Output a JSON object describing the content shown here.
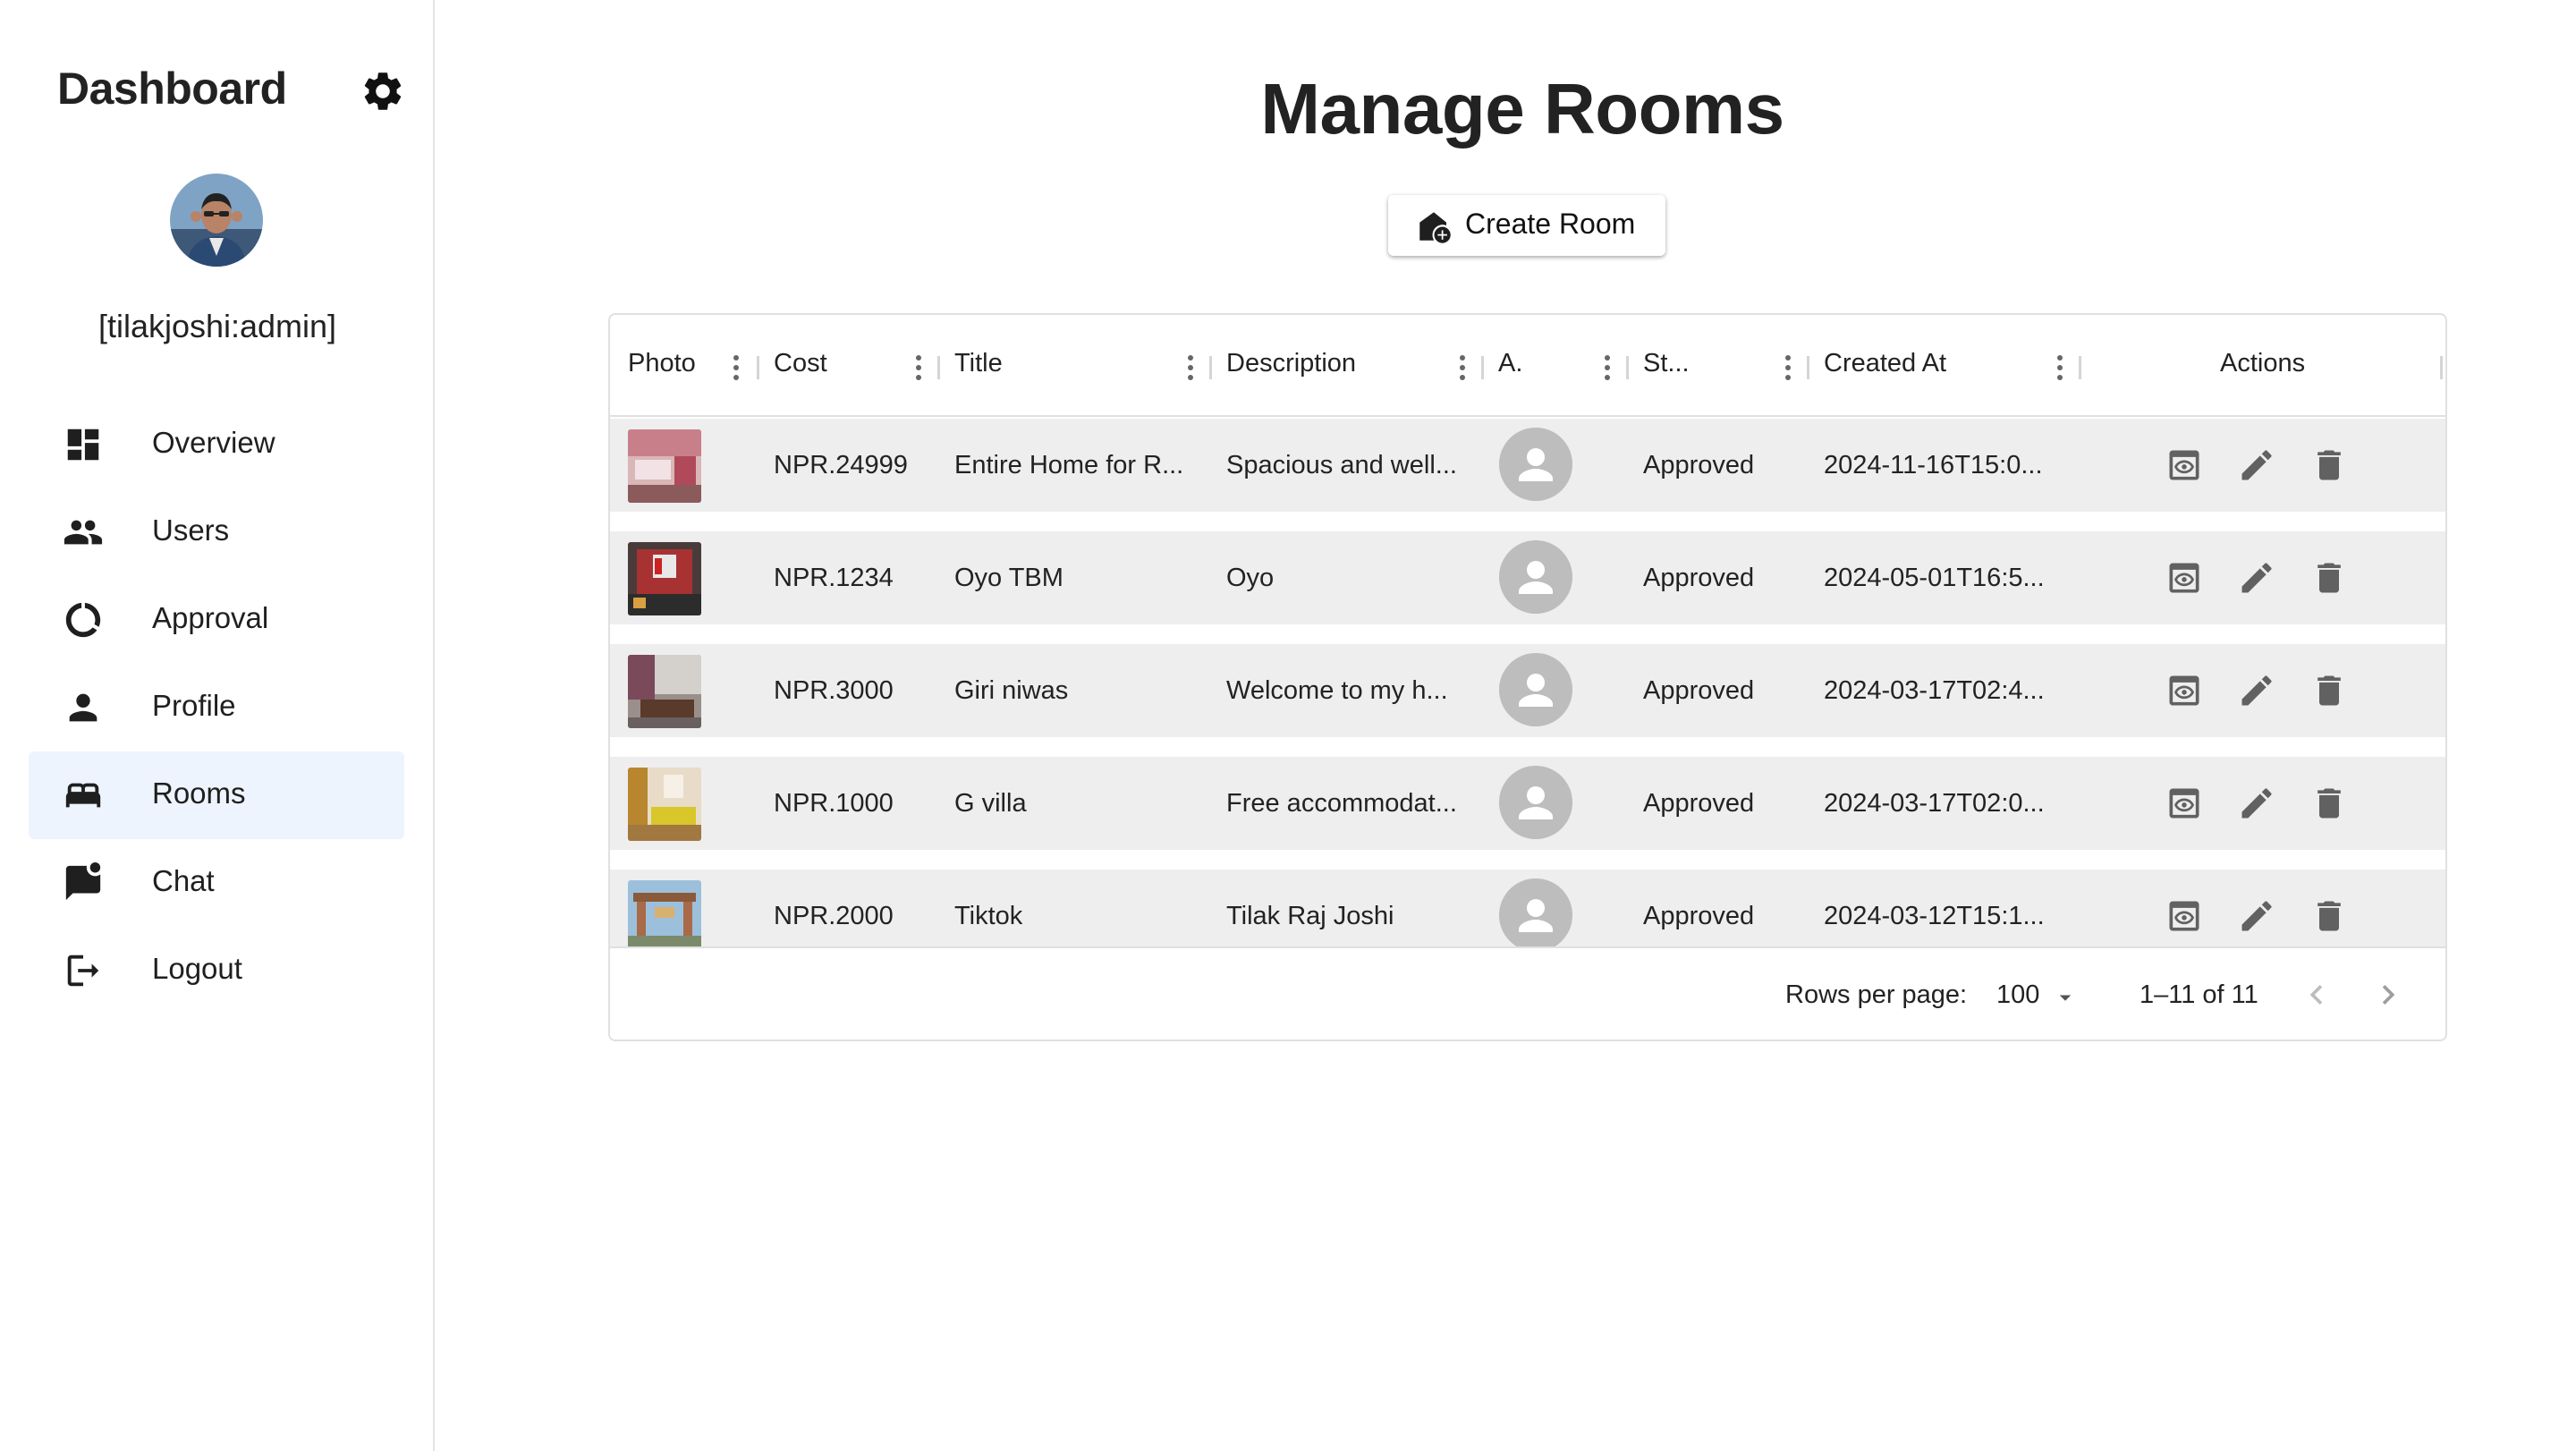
{
  "sidebar": {
    "title": "Dashboard",
    "username": "[tilakjoshi:admin]",
    "items": [
      {
        "label": "Overview",
        "icon": "dashboard-icon"
      },
      {
        "label": "Users",
        "icon": "people-icon"
      },
      {
        "label": "Approval",
        "icon": "donut-icon"
      },
      {
        "label": "Profile",
        "icon": "person-icon"
      },
      {
        "label": "Rooms",
        "icon": "bed-icon"
      },
      {
        "label": "Chat",
        "icon": "chat-icon"
      },
      {
        "label": "Logout",
        "icon": "logout-icon"
      }
    ],
    "active_item": "Rooms"
  },
  "main": {
    "title": "Manage Rooms",
    "create_button": "Create Room"
  },
  "grid": {
    "columns": [
      "Photo",
      "Cost",
      "Title",
      "Description",
      "A.",
      "St...",
      "Created At",
      "Actions"
    ],
    "rows": [
      {
        "cost": "NPR.24999",
        "title": "Entire Home for R...",
        "description": "Spacious and well...",
        "status": "Approved",
        "created_at": "2024-11-16T15:0..."
      },
      {
        "cost": "NPR.1234",
        "title": "Oyo TBM",
        "description": "Oyo",
        "status": "Approved",
        "created_at": "2024-05-01T16:5..."
      },
      {
        "cost": "NPR.3000",
        "title": "Giri niwas",
        "description": "Welcome to my h...",
        "status": "Approved",
        "created_at": "2024-03-17T02:4..."
      },
      {
        "cost": "NPR.1000",
        "title": "G villa",
        "description": "Free accommodat...",
        "status": "Approved",
        "created_at": "2024-03-17T02:0..."
      },
      {
        "cost": "NPR.2000",
        "title": "Tiktok",
        "description": "Tilak Raj Joshi",
        "status": "Approved",
        "created_at": "2024-03-12T15:1..."
      }
    ],
    "footer": {
      "rows_per_page_label": "Rows per page:",
      "rows_per_page_value": "100",
      "range": "1–11 of 11"
    }
  },
  "colors": {
    "active_nav_bg": "#edf4fd",
    "row_bg": "#eeeeee",
    "icon_gray": "#616161",
    "avatar_placeholder": "#bdbdbd"
  }
}
